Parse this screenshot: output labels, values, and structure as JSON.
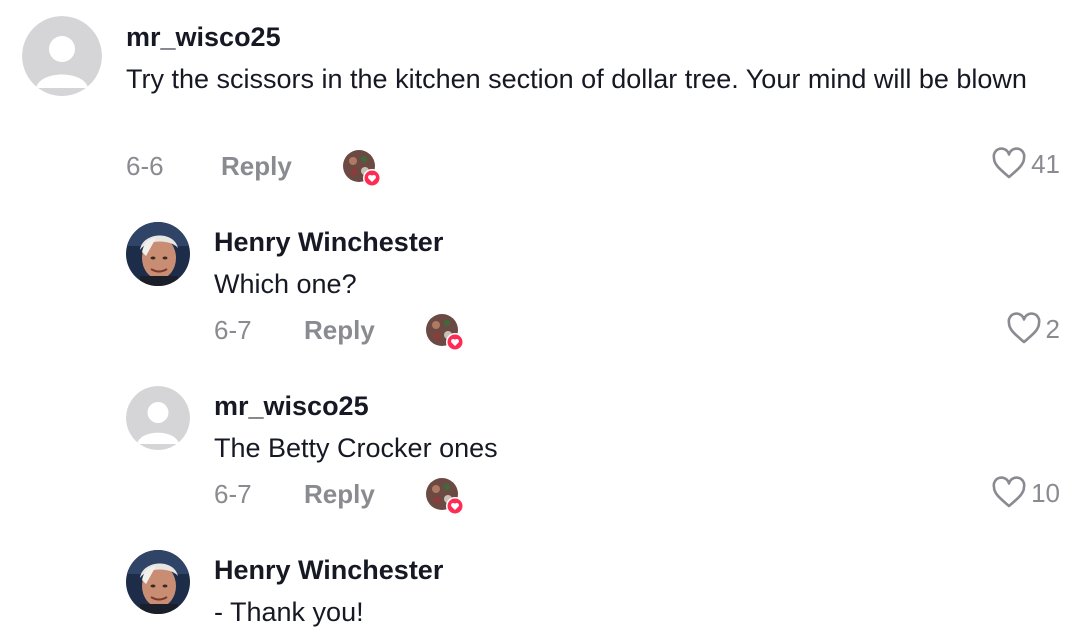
{
  "comments": [
    {
      "author": "mr_wisco25",
      "text": "Try the scissors in the kitchen section of dollar tree. Your mind will be blown",
      "date": "6-6",
      "reply_label": "Reply",
      "likes": "41",
      "avatar": "default-avatar-icon"
    },
    {
      "author": "Henry Winchester",
      "text": "Which one?",
      "date": "6-7",
      "reply_label": "Reply",
      "likes": "2",
      "avatar": "user-photo-avatar"
    },
    {
      "author": "mr_wisco25",
      "text": "The Betty Crocker ones",
      "date": "6-7",
      "reply_label": "Reply",
      "likes": "10",
      "avatar": "default-avatar-icon"
    },
    {
      "author": "Henry Winchester",
      "text": "- Thank you!",
      "avatar": "user-photo-avatar"
    }
  ],
  "colors": {
    "text_primary": "#161823",
    "text_secondary": "#8a8b91",
    "heart_badge": "#fe2c55",
    "default_avatar_bg": "#d5d5d7"
  }
}
